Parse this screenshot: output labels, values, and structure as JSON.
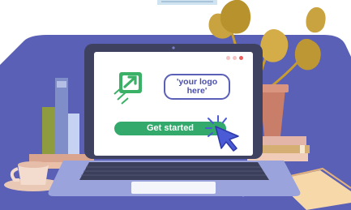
{
  "screen": {
    "logo_placeholder_text": "'your logo\nhere'",
    "cta_label": "Get started"
  },
  "window_dots": [
    "#f4c2c2",
    "#f4c2c2",
    "#f05d5d"
  ],
  "colors": {
    "accent_green": "#33a96b",
    "panel_blue": "#5a60b5",
    "laptop_dark": "#3e4260",
    "cursor_blue": "#4b5bd6"
  },
  "icons": [
    "growth-arrow-icon",
    "mouse-pointer-icon"
  ]
}
